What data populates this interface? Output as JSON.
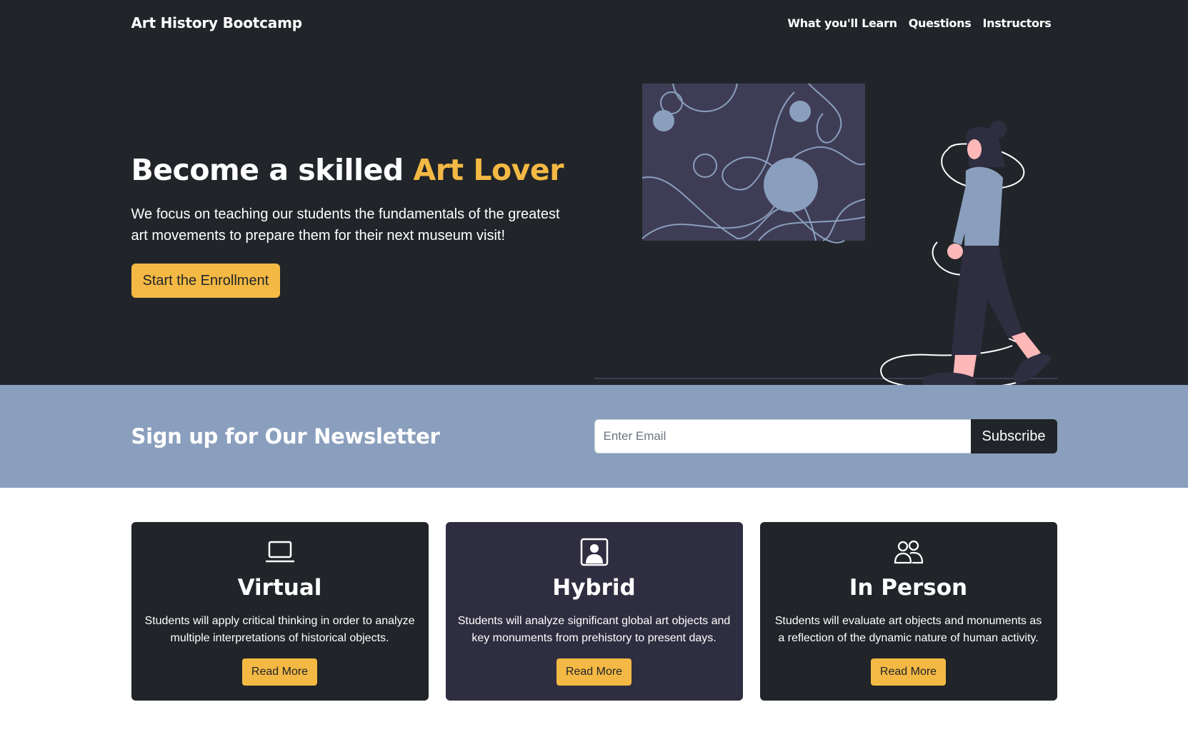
{
  "navbar": {
    "brand": "Art History Bootcamp",
    "links": [
      "What you'll Learn",
      "Questions",
      "Instructors"
    ]
  },
  "hero": {
    "title_prefix": "Become a skilled",
    "title_accent": "Art Lover",
    "lead": "We focus on teaching our students the fundamentals of the greatest art movements to prepare them for their next museum visit!",
    "cta_label": "Start the Enrollment",
    "illustration_icon": "woman-walking-past-painting-illustration"
  },
  "newsletter": {
    "title": "Sign up for Our Newsletter",
    "email_placeholder": "Enter Email",
    "email_value": "",
    "subscribe_label": "Subscribe"
  },
  "cards": [
    {
      "icon": "laptop-icon",
      "title": "Virtual",
      "text": "Students will apply critical thinking in order to analyze multiple interpretations of historical objects.",
      "button_label": "Read More"
    },
    {
      "icon": "person-square-icon",
      "title": "Hybrid",
      "text": "Students will analyze significant global art objects and key monuments from prehistory to present days.",
      "button_label": "Read More"
    },
    {
      "icon": "people-icon",
      "title": "In Person",
      "text": "Students will evaluate art objects and monuments as a reflection of the dynamic nature of human activity.",
      "button_label": "Read More"
    }
  ],
  "colors": {
    "dark": "#212529",
    "accent": "#f4b944",
    "newsletter_bg": "#8a9fbd",
    "card_mid": "#2f2e41"
  }
}
